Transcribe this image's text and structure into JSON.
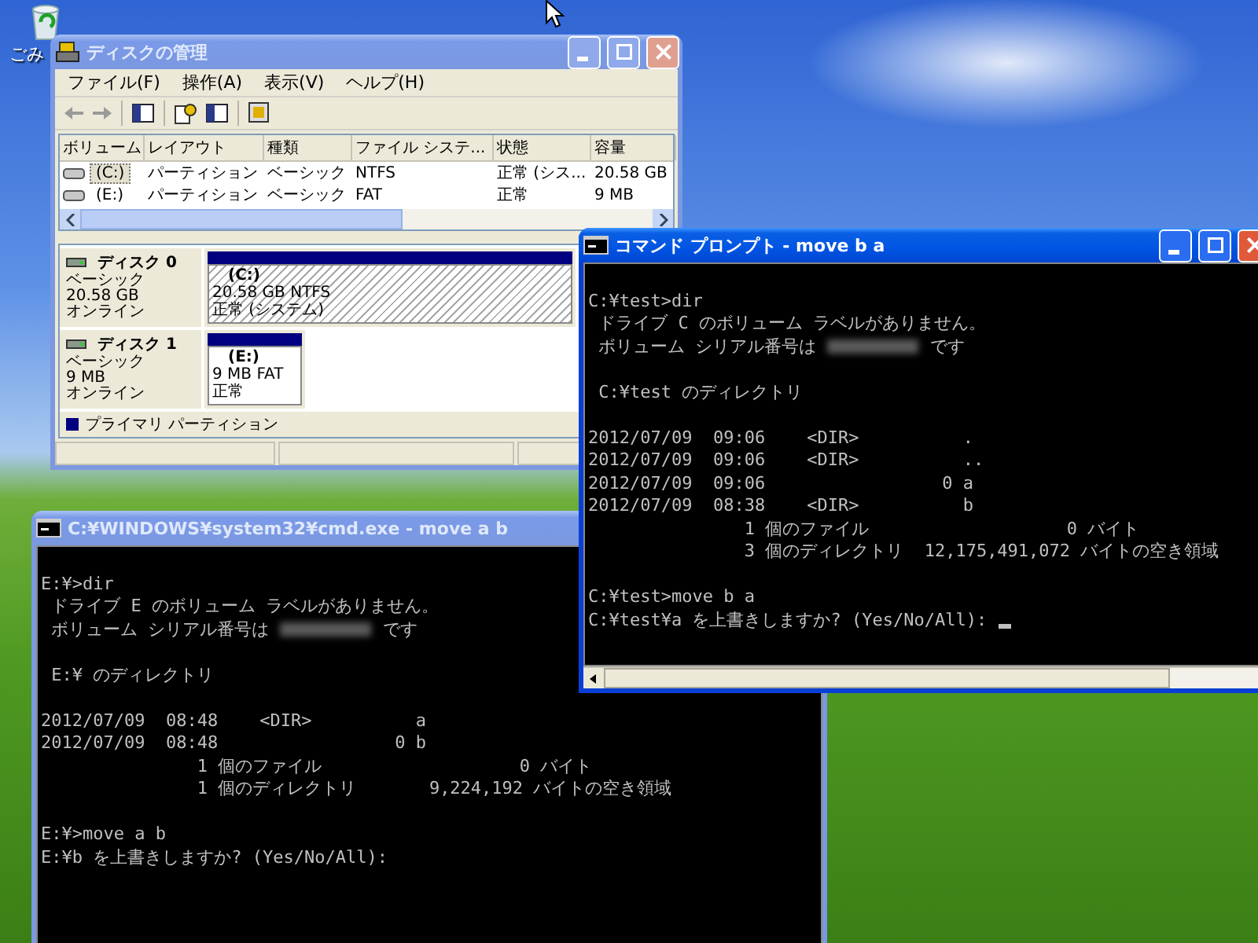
{
  "desktop": {
    "recycle_bin_label": "ごみ"
  },
  "disk_management": {
    "title": "ディスクの管理",
    "active": false,
    "menu": [
      "ファイル(F)",
      "操作(A)",
      "表示(V)",
      "ヘルプ(H)"
    ],
    "volume_table": {
      "columns": [
        "ボリューム",
        "レイアウト",
        "種類",
        "ファイル システ...",
        "状態",
        "容量"
      ],
      "rows": [
        {
          "selected": true,
          "cells": [
            "(C:)",
            "パーティション",
            "ベーシック",
            "NTFS",
            "正常 (シス...",
            "20.58 GB"
          ]
        },
        {
          "selected": false,
          "cells": [
            "(E:)",
            "パーティション",
            "ベーシック",
            "FAT",
            "正常",
            "9 MB"
          ]
        }
      ]
    },
    "disks": [
      {
        "name": "ディスク 0",
        "type": "ベーシック",
        "size": "20.58 GB",
        "status": "オンライン",
        "partition": {
          "kind": "wide",
          "selected": true,
          "label": "(C:)",
          "info": "20.58 GB NTFS",
          "status": "正常 (システム)"
        }
      },
      {
        "name": "ディスク 1",
        "type": "ベーシック",
        "size": "9 MB",
        "status": "オンライン",
        "partition": {
          "kind": "narrow",
          "selected": false,
          "label": "(E:)",
          "info": "9 MB FAT",
          "status": "正常"
        }
      }
    ],
    "legend": "プライマリ パーティション"
  },
  "consoles": [
    {
      "title": "コマンド プロンプト - move b a",
      "active": true,
      "cursor_visible": true,
      "lines": [
        {
          "kind": "blank"
        },
        {
          "kind": "text",
          "text": "C:¥test>dir"
        },
        {
          "kind": "text",
          "text": " ドライブ C のボリューム ラベルがありません。"
        },
        {
          "kind": "serial",
          "before": " ボリューム シリアル番号は",
          "after": "です"
        },
        {
          "kind": "blank"
        },
        {
          "kind": "text",
          "text": " C:¥test のディレクトリ"
        },
        {
          "kind": "blank"
        },
        {
          "kind": "text",
          "text": "2012/07/09  09:06    <DIR>          ."
        },
        {
          "kind": "text",
          "text": "2012/07/09  09:06    <DIR>          .."
        },
        {
          "kind": "text",
          "text": "2012/07/09  09:06                 0 a"
        },
        {
          "kind": "text",
          "text": "2012/07/09  08:38    <DIR>          b"
        },
        {
          "kind": "text",
          "text": "               1 個のファイル                   0 バイト"
        },
        {
          "kind": "text",
          "text": "               3 個のディレクトリ  12,175,491,072 バイトの空き領域"
        },
        {
          "kind": "blank"
        },
        {
          "kind": "text",
          "text": "C:¥test>move b a"
        },
        {
          "kind": "prompt",
          "text": "C:¥test¥a を上書きしますか? (Yes/No/All):"
        }
      ]
    },
    {
      "title": "C:¥WINDOWS¥system32¥cmd.exe - move a b",
      "active": false,
      "cursor_visible": false,
      "lines": [
        {
          "kind": "blank"
        },
        {
          "kind": "text",
          "text": "E:¥>dir"
        },
        {
          "kind": "text",
          "text": " ドライブ E のボリューム ラベルがありません。"
        },
        {
          "kind": "serial",
          "before": " ボリューム シリアル番号は",
          "after": "です"
        },
        {
          "kind": "blank"
        },
        {
          "kind": "text",
          "text": " E:¥ のディレクトリ"
        },
        {
          "kind": "blank"
        },
        {
          "kind": "text",
          "text": "2012/07/09  08:48    <DIR>          a"
        },
        {
          "kind": "text",
          "text": "2012/07/09  08:48                 0 b"
        },
        {
          "kind": "text",
          "text": "               1 個のファイル                   0 バイト"
        },
        {
          "kind": "text",
          "text": "               1 個のディレクトリ       9,224,192 バイトの空き領域"
        },
        {
          "kind": "blank"
        },
        {
          "kind": "text",
          "text": "E:¥>move a b"
        },
        {
          "kind": "prompt",
          "text": "E:¥b を上書きしますか? (Yes/No/All):"
        }
      ]
    }
  ]
}
